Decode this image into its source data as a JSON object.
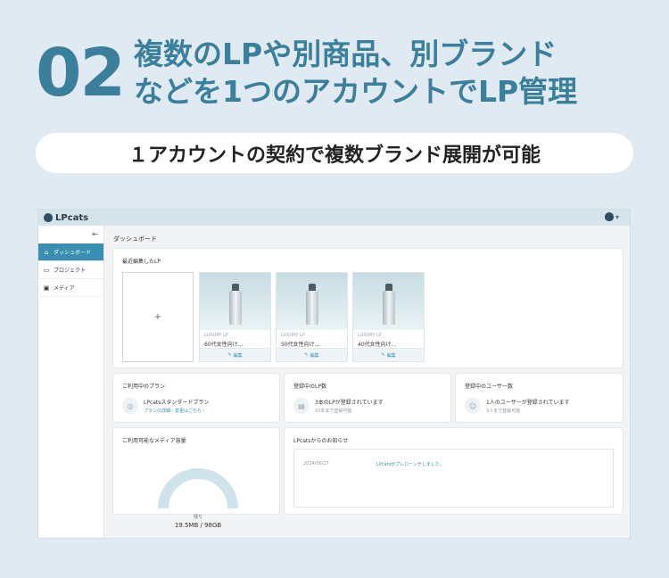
{
  "hero": {
    "number": "02",
    "title_line1": "複数のLPや別商品、別ブランド",
    "title_line2": "などを1つのアカウントでLP管理",
    "subtitle": "１アカウントの契約で複数ブランド展開が可能"
  },
  "colors": {
    "accent": "#3a7f9c",
    "active": "#3a8fb0",
    "background": "#dfeaf2"
  },
  "app": {
    "logo": "LPcats",
    "user_caret": "▾",
    "collapse_icon": "⇤",
    "sidebar": [
      {
        "label": "ダッシュボード",
        "icon": "home-icon",
        "active": true
      },
      {
        "label": "プロジェクト",
        "icon": "folder-icon",
        "active": false
      },
      {
        "label": "メディア",
        "icon": "image-icon",
        "active": false
      }
    ],
    "page_title": "ダッシュボード",
    "recent": {
      "title": "最近編集したLP",
      "add_label": "+",
      "items": [
        {
          "category": "LUXURY LP",
          "name": "60代女性向け...",
          "edit": "編集"
        },
        {
          "category": "LUXURY LP",
          "name": "50代女性向け...",
          "edit": "編集"
        },
        {
          "category": "LUXURY LP",
          "name": "40代女性向け...",
          "edit": "編集"
        }
      ]
    },
    "plan": {
      "title": "ご利用中のプラン",
      "main": "LPcatsスタンダードプラン",
      "link": "プランの詳細・変更はこちら ›"
    },
    "lp_count": {
      "title": "登録中のLP数",
      "main": "3本のLPが登録されています",
      "sub": "10本まで登録可能"
    },
    "users": {
      "title": "登録中のユーザー数",
      "main": "1人のユーザーが登録されています",
      "sub": "3人まで登録可能"
    },
    "media": {
      "title": "ご利用可能なメディア容量",
      "label": "残り",
      "value": "19.5MB / 98GB",
      "used_fraction": 0.0002
    },
    "news": {
      "title": "LPcatsからのお知らせ",
      "date": "2024/06/27",
      "text": "LPcatsがプレローンチしました。"
    }
  }
}
